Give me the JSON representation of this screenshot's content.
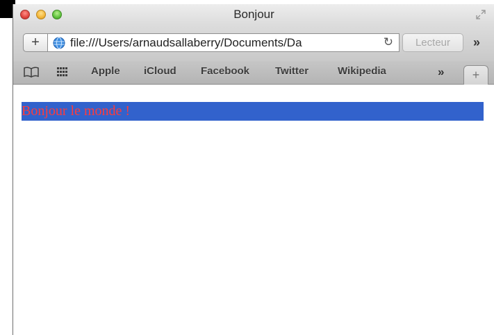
{
  "window": {
    "title": "Bonjour"
  },
  "toolbar": {
    "add_button_label": "+",
    "address_url": "file:///Users/arnaudsallaberry/Documents/Da",
    "reload_icon": "reload-icon",
    "reader_label": "Lecteur",
    "overflow_label": "»"
  },
  "bookmarks": {
    "items": [
      {
        "label": "Apple"
      },
      {
        "label": "iCloud"
      },
      {
        "label": "Facebook"
      },
      {
        "label": "Twitter"
      },
      {
        "label": "Wikipedia"
      }
    ],
    "more_label": "»",
    "new_tab_label": "+"
  },
  "page": {
    "heading": "Bonjour le monde !",
    "heading_color": "#ff3b3b",
    "heading_background": "#3262cc"
  }
}
